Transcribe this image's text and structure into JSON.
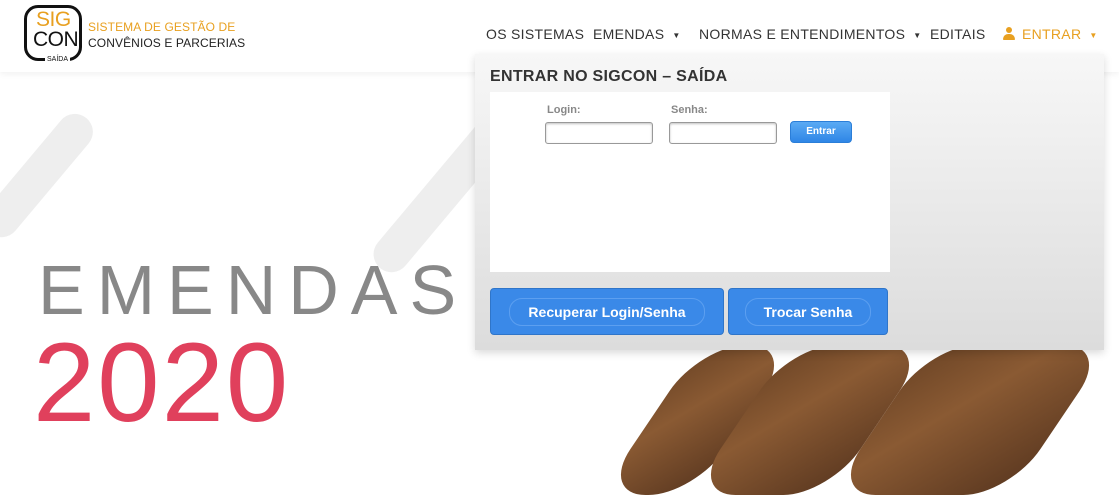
{
  "brand": {
    "logo_line1": "SIG",
    "logo_line2": "CON",
    "logo_sub": "SAÍDA",
    "title_line1": "SISTEMA DE GESTÃO DE",
    "title_line2": "CONVÊNIOS E PARCERIAS"
  },
  "nav": {
    "items": [
      {
        "label": "OS SISTEMAS"
      },
      {
        "label": "EMENDAS"
      },
      {
        "label": "NORMAS E ENTENDIMENTOS"
      },
      {
        "label": "EDITAIS"
      },
      {
        "label": "ENTRAR"
      }
    ],
    "caret": "▼"
  },
  "hero": {
    "title": "EMENDAS",
    "year": "2020"
  },
  "login": {
    "heading": "ENTRAR NO SIGCON – SAÍDA",
    "login_label": "Login:",
    "login_value": "",
    "password_label": "Senha:",
    "password_value": "",
    "submit_label": "Entrar",
    "recover_label": "Recuperar Login/Senha",
    "change_password_label": "Trocar Senha"
  },
  "colors": {
    "accent": "#e8a020",
    "hero_year": "#e0405c",
    "button_blue": "#3a89e8"
  }
}
